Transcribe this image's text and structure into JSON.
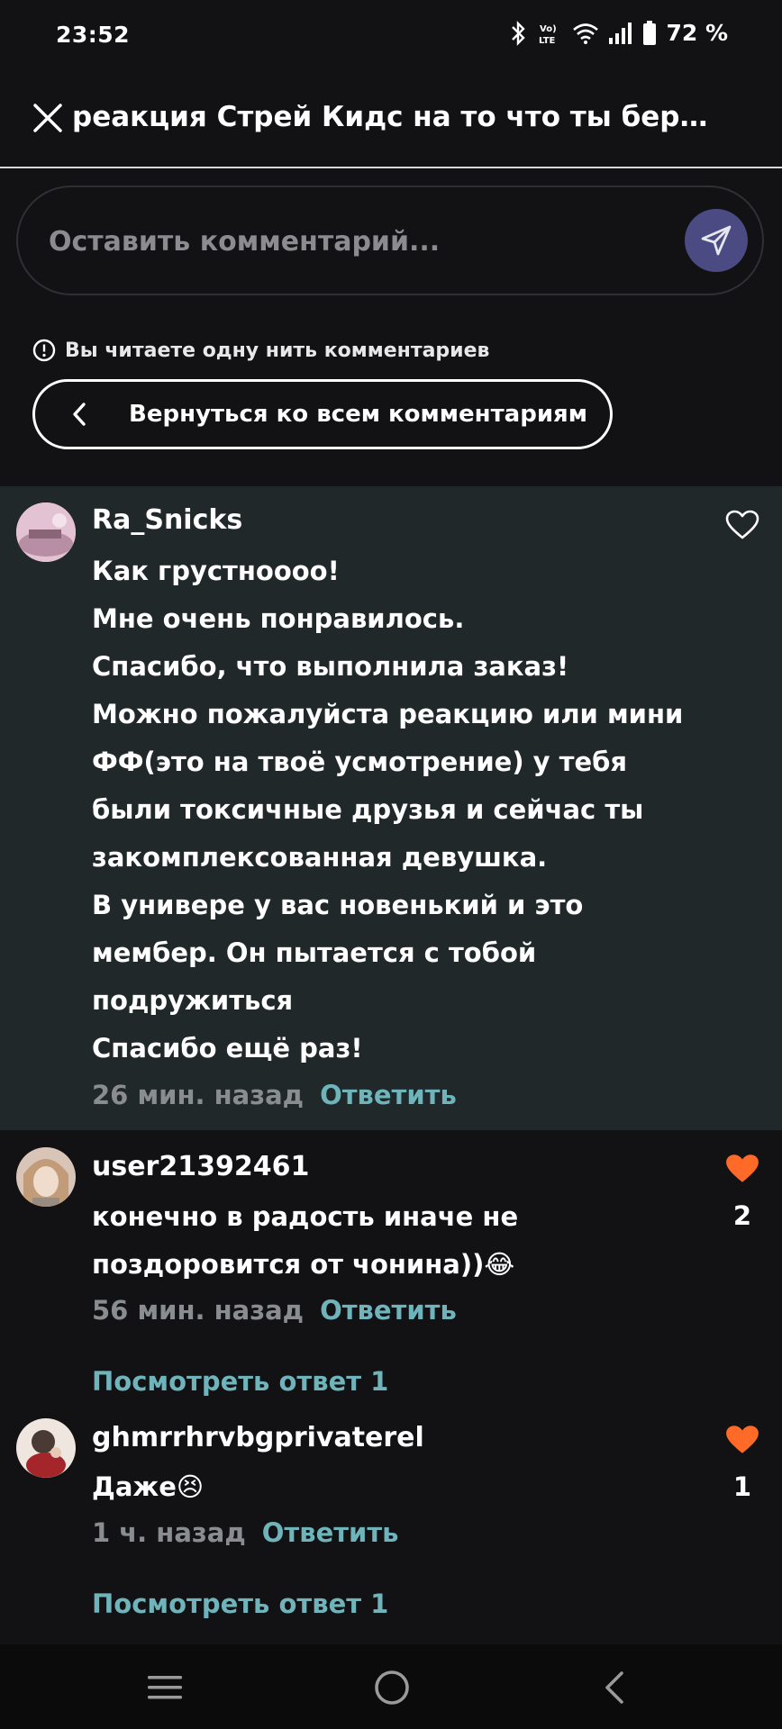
{
  "status": {
    "time": "23:52",
    "battery": "72 %",
    "icons": [
      "bluetooth-icon",
      "volte-icon",
      "wifi-icon",
      "signal-icon",
      "battery-icon"
    ]
  },
  "header": {
    "title": "реакция Стрей Кидс на то что ты береме..."
  },
  "comment_input": {
    "placeholder": "Оставить комментарий..."
  },
  "thread": {
    "notice": "Вы читаете одну нить комментариев",
    "back_label": "Вернуться ко всем комментариям"
  },
  "comments": [
    {
      "username": "Ra_Snicks",
      "lines": [
        "Как грустноооо!",
        "Мне очень понравилось.",
        "Спасибо, что выполнила заказ!",
        "Можно пожалуйста реакцию или мини",
        "ФФ(это на твоё усмотрение) у тебя",
        "были токсичные друзья и сейчас ты",
        "закомплексованная девушка.",
        "В универе у вас новенький и это",
        "мембер. Он пытается с тобой",
        "подружиться",
        "Спасибо ещё раз!"
      ],
      "time": "26 мин. назад",
      "reply": "Ответить",
      "liked": false,
      "likes": ""
    },
    {
      "username": "user21392461",
      "lines": [
        "конечно в радость иначе не",
        "поздоровится от чонина))😂"
      ],
      "time": "56 мин. назад",
      "reply": "Ответить",
      "liked": true,
      "likes": "2",
      "view_replies": "Посмотреть ответ 1"
    },
    {
      "username": "ghmrrhrvbgprivaterel",
      "lines": [
        "Даже😣"
      ],
      "time": "1 ч. назад",
      "reply": "Ответить",
      "liked": true,
      "likes": "1",
      "view_replies": "Посмотреть ответ 1"
    }
  ],
  "colors": {
    "accent_like": "#ff6a28",
    "link": "#6fb4bb",
    "send_button": "#4c4a82",
    "highlight_bg": "#212829"
  }
}
